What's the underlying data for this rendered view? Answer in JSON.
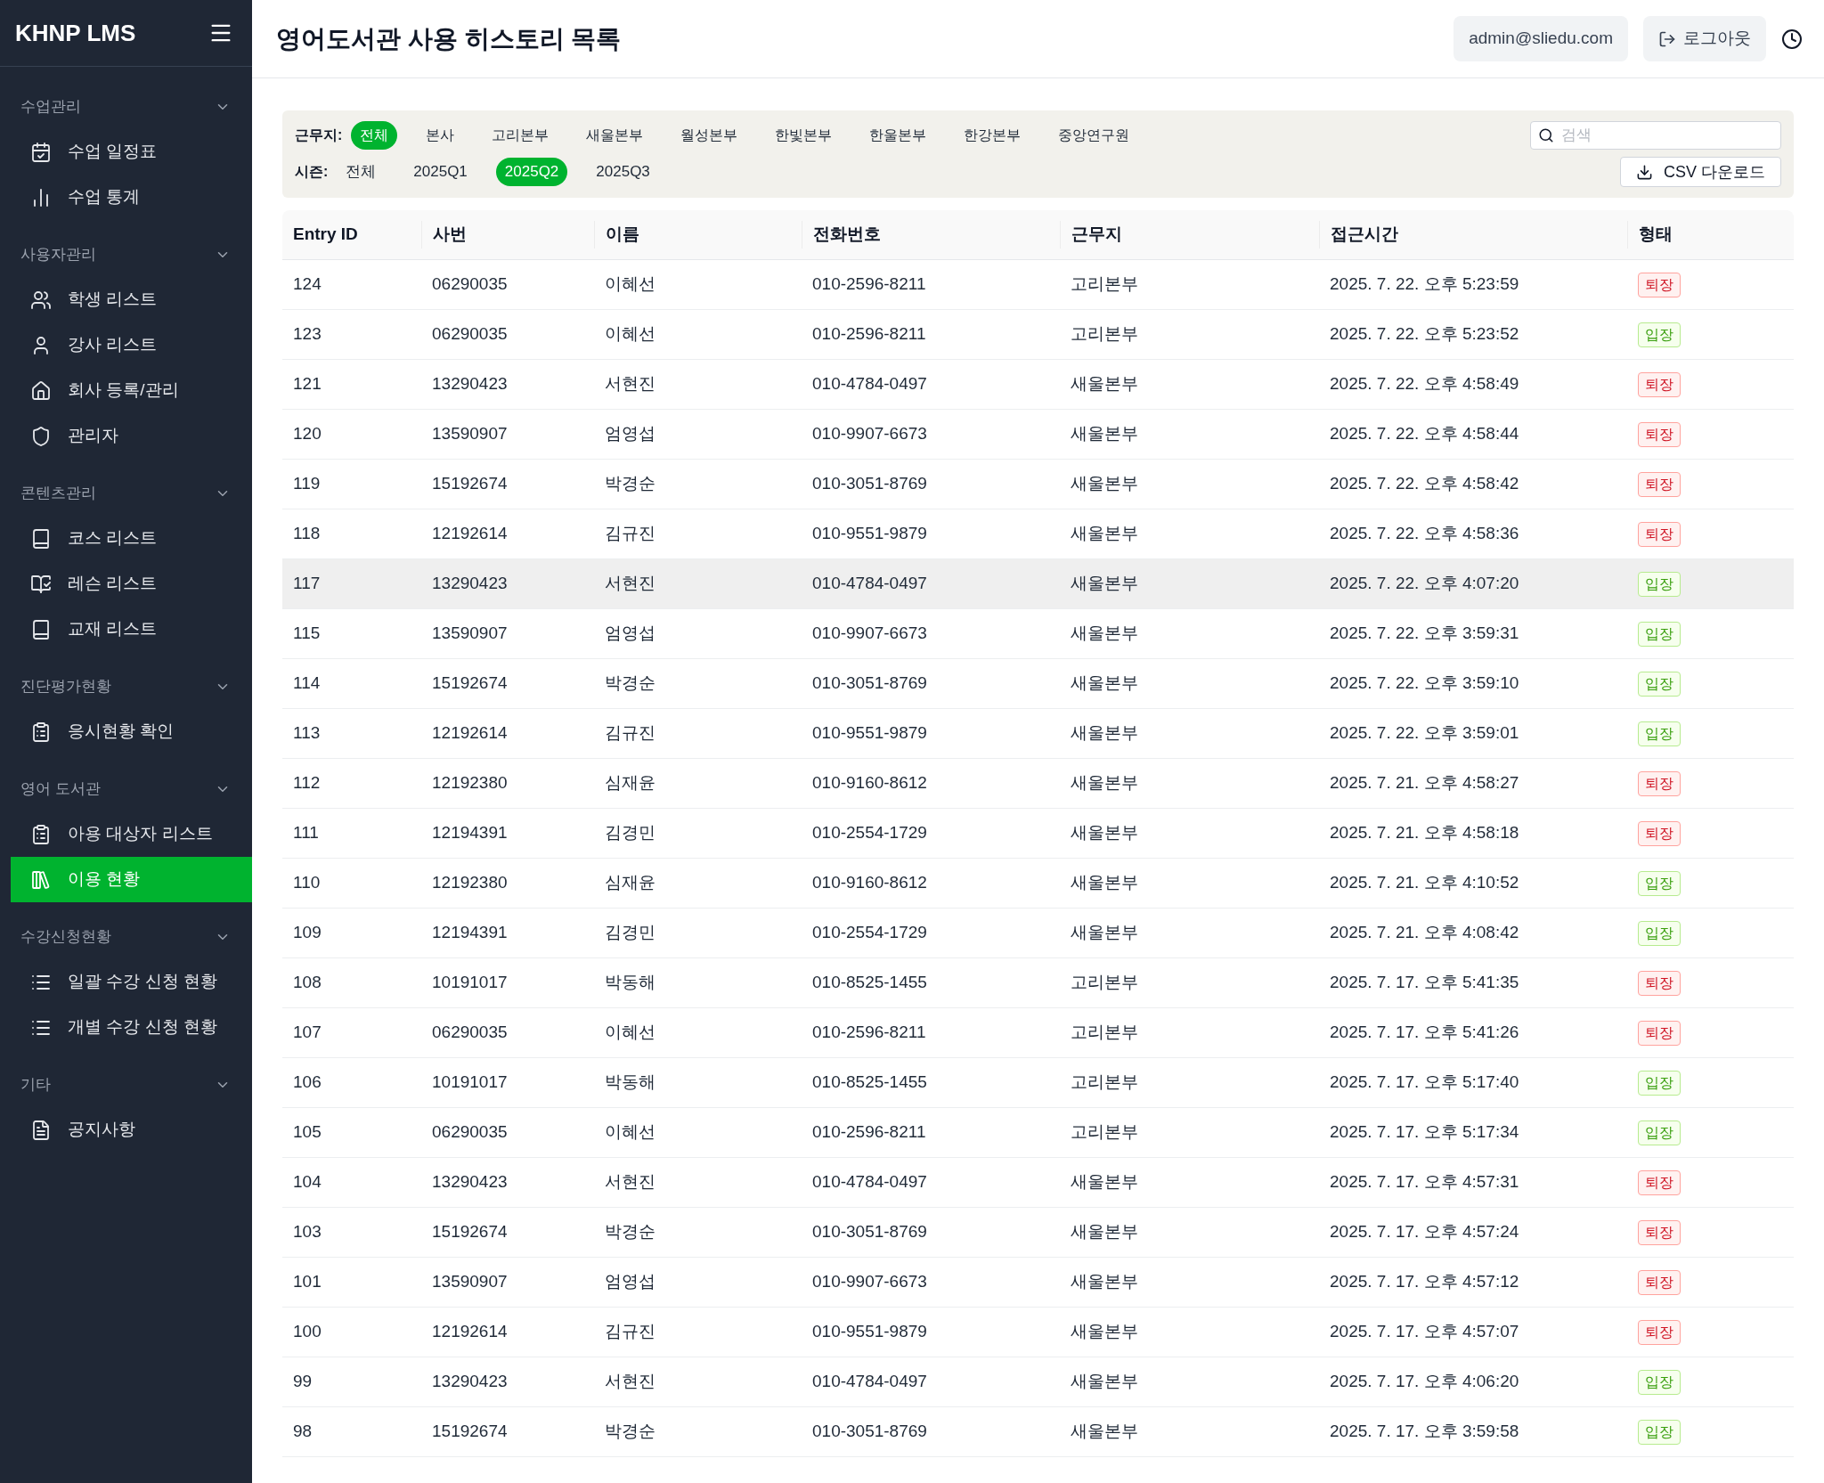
{
  "sidebar": {
    "brand": "KHNP LMS",
    "sections": [
      {
        "title": "수업관리",
        "expanded": true,
        "items": [
          {
            "label": "수업 일정표",
            "selected": false
          },
          {
            "label": "수업 통계",
            "selected": false
          }
        ]
      },
      {
        "title": "사용자관리",
        "expanded": true,
        "items": [
          {
            "label": "학생 리스트",
            "selected": false
          },
          {
            "label": "강사 리스트",
            "selected": false
          },
          {
            "label": "회사 등록/관리",
            "selected": false
          },
          {
            "label": "관리자",
            "selected": false
          }
        ]
      },
      {
        "title": "콘텐츠관리",
        "expanded": true,
        "items": [
          {
            "label": "코스 리스트",
            "selected": false
          },
          {
            "label": "레슨 리스트",
            "selected": false
          },
          {
            "label": "교재 리스트",
            "selected": false
          }
        ]
      },
      {
        "title": "진단평가현황",
        "expanded": true,
        "items": [
          {
            "label": "응시현황 확인",
            "selected": false
          }
        ]
      },
      {
        "title": "영어 도서관",
        "expanded": true,
        "items": [
          {
            "label": "아용 대상자 리스트",
            "selected": false
          },
          {
            "label": "이용 현황",
            "selected": true
          }
        ]
      },
      {
        "title": "수강신청현황",
        "expanded": true,
        "items": [
          {
            "label": "일괄 수강 신청 현황",
            "selected": false
          },
          {
            "label": "개별 수강 신청 현황",
            "selected": false
          }
        ]
      },
      {
        "title": "기타",
        "expanded": true,
        "items": [
          {
            "label": "공지사항",
            "selected": false
          }
        ]
      }
    ]
  },
  "header": {
    "title": "영어도서관 사용 히스토리 목록",
    "user": "admin@sliedu.com",
    "logout": "로그아웃"
  },
  "filters": {
    "workplace_label": "근무지:",
    "workplaces": [
      {
        "label": "전체",
        "selected": true
      },
      {
        "label": "본사",
        "selected": false
      },
      {
        "label": "고리본부",
        "selected": false
      },
      {
        "label": "새울본부",
        "selected": false
      },
      {
        "label": "월성본부",
        "selected": false
      },
      {
        "label": "한빛본부",
        "selected": false
      },
      {
        "label": "한울본부",
        "selected": false
      },
      {
        "label": "한강본부",
        "selected": false
      },
      {
        "label": "중앙연구원",
        "selected": false
      }
    ],
    "season_label": "시즌:",
    "seasons": [
      {
        "label": "전체",
        "selected": false
      },
      {
        "label": "2025Q1",
        "selected": false
      },
      {
        "label": "2025Q2",
        "selected": true
      },
      {
        "label": "2025Q3",
        "selected": false
      }
    ],
    "search": {
      "placeholder": "검색"
    },
    "csv_button": "CSV 다운로드"
  },
  "table": {
    "columns": [
      "Entry ID",
      "사번",
      "이름",
      "전화번호",
      "근무지",
      "접근시간",
      "형태"
    ],
    "rows": [
      {
        "cells": [
          "124",
          "06290035",
          "이혜선",
          "010-2596-8211",
          "고리본부",
          "2025. 7. 22. 오후 5:23:59"
        ],
        "status": "퇴장",
        "kind": "exit",
        "selected": false
      },
      {
        "cells": [
          "123",
          "06290035",
          "이혜선",
          "010-2596-8211",
          "고리본부",
          "2025. 7. 22. 오후 5:23:52"
        ],
        "status": "입장",
        "kind": "enter",
        "selected": false
      },
      {
        "cells": [
          "121",
          "13290423",
          "서현진",
          "010-4784-0497",
          "새울본부",
          "2025. 7. 22. 오후 4:58:49"
        ],
        "status": "퇴장",
        "kind": "exit",
        "selected": false
      },
      {
        "cells": [
          "120",
          "13590907",
          "엄영섭",
          "010-9907-6673",
          "새울본부",
          "2025. 7. 22. 오후 4:58:44"
        ],
        "status": "퇴장",
        "kind": "exit",
        "selected": false
      },
      {
        "cells": [
          "119",
          "15192674",
          "박경순",
          "010-3051-8769",
          "새울본부",
          "2025. 7. 22. 오후 4:58:42"
        ],
        "status": "퇴장",
        "kind": "exit",
        "selected": false
      },
      {
        "cells": [
          "118",
          "12192614",
          "김규진",
          "010-9551-9879",
          "새울본부",
          "2025. 7. 22. 오후 4:58:36"
        ],
        "status": "퇴장",
        "kind": "exit",
        "selected": false
      },
      {
        "cells": [
          "117",
          "13290423",
          "서현진",
          "010-4784-0497",
          "새울본부",
          "2025. 7. 22. 오후 4:07:20"
        ],
        "status": "입장",
        "kind": "enter",
        "selected": true
      },
      {
        "cells": [
          "115",
          "13590907",
          "엄영섭",
          "010-9907-6673",
          "새울본부",
          "2025. 7. 22. 오후 3:59:31"
        ],
        "status": "입장",
        "kind": "enter",
        "selected": false
      },
      {
        "cells": [
          "114",
          "15192674",
          "박경순",
          "010-3051-8769",
          "새울본부",
          "2025. 7. 22. 오후 3:59:10"
        ],
        "status": "입장",
        "kind": "enter",
        "selected": false
      },
      {
        "cells": [
          "113",
          "12192614",
          "김규진",
          "010-9551-9879",
          "새울본부",
          "2025. 7. 22. 오후 3:59:01"
        ],
        "status": "입장",
        "kind": "enter",
        "selected": false
      },
      {
        "cells": [
          "112",
          "12192380",
          "심재윤",
          "010-9160-8612",
          "새울본부",
          "2025. 7. 21. 오후 4:58:27"
        ],
        "status": "퇴장",
        "kind": "exit",
        "selected": false
      },
      {
        "cells": [
          "111",
          "12194391",
          "김경민",
          "010-2554-1729",
          "새울본부",
          "2025. 7. 21. 오후 4:58:18"
        ],
        "status": "퇴장",
        "kind": "exit",
        "selected": false
      },
      {
        "cells": [
          "110",
          "12192380",
          "심재윤",
          "010-9160-8612",
          "새울본부",
          "2025. 7. 21. 오후 4:10:52"
        ],
        "status": "입장",
        "kind": "enter",
        "selected": false
      },
      {
        "cells": [
          "109",
          "12194391",
          "김경민",
          "010-2554-1729",
          "새울본부",
          "2025. 7. 21. 오후 4:08:42"
        ],
        "status": "입장",
        "kind": "enter",
        "selected": false
      },
      {
        "cells": [
          "108",
          "10191017",
          "박동해",
          "010-8525-1455",
          "고리본부",
          "2025. 7. 17. 오후 5:41:35"
        ],
        "status": "퇴장",
        "kind": "exit",
        "selected": false
      },
      {
        "cells": [
          "107",
          "06290035",
          "이혜선",
          "010-2596-8211",
          "고리본부",
          "2025. 7. 17. 오후 5:41:26"
        ],
        "status": "퇴장",
        "kind": "exit",
        "selected": false
      },
      {
        "cells": [
          "106",
          "10191017",
          "박동해",
          "010-8525-1455",
          "고리본부",
          "2025. 7. 17. 오후 5:17:40"
        ],
        "status": "입장",
        "kind": "enter",
        "selected": false
      },
      {
        "cells": [
          "105",
          "06290035",
          "이혜선",
          "010-2596-8211",
          "고리본부",
          "2025. 7. 17. 오후 5:17:34"
        ],
        "status": "입장",
        "kind": "enter",
        "selected": false
      },
      {
        "cells": [
          "104",
          "13290423",
          "서현진",
          "010-4784-0497",
          "새울본부",
          "2025. 7. 17. 오후 4:57:31"
        ],
        "status": "퇴장",
        "kind": "exit",
        "selected": false
      },
      {
        "cells": [
          "103",
          "15192674",
          "박경순",
          "010-3051-8769",
          "새울본부",
          "2025. 7. 17. 오후 4:57:24"
        ],
        "status": "퇴장",
        "kind": "exit",
        "selected": false
      },
      {
        "cells": [
          "101",
          "13590907",
          "엄영섭",
          "010-9907-6673",
          "새울본부",
          "2025. 7. 17. 오후 4:57:12"
        ],
        "status": "퇴장",
        "kind": "exit",
        "selected": false
      },
      {
        "cells": [
          "100",
          "12192614",
          "김규진",
          "010-9551-9879",
          "새울본부",
          "2025. 7. 17. 오후 4:57:07"
        ],
        "status": "퇴장",
        "kind": "exit",
        "selected": false
      },
      {
        "cells": [
          "99",
          "13290423",
          "서현진",
          "010-4784-0497",
          "새울본부",
          "2025. 7. 17. 오후 4:06:20"
        ],
        "status": "입장",
        "kind": "enter",
        "selected": false
      },
      {
        "cells": [
          "98",
          "15192674",
          "박경순",
          "010-3051-8769",
          "새울본부",
          "2025. 7. 17. 오후 3:59:58"
        ],
        "status": "입장",
        "kind": "enter",
        "selected": false
      }
    ]
  }
}
